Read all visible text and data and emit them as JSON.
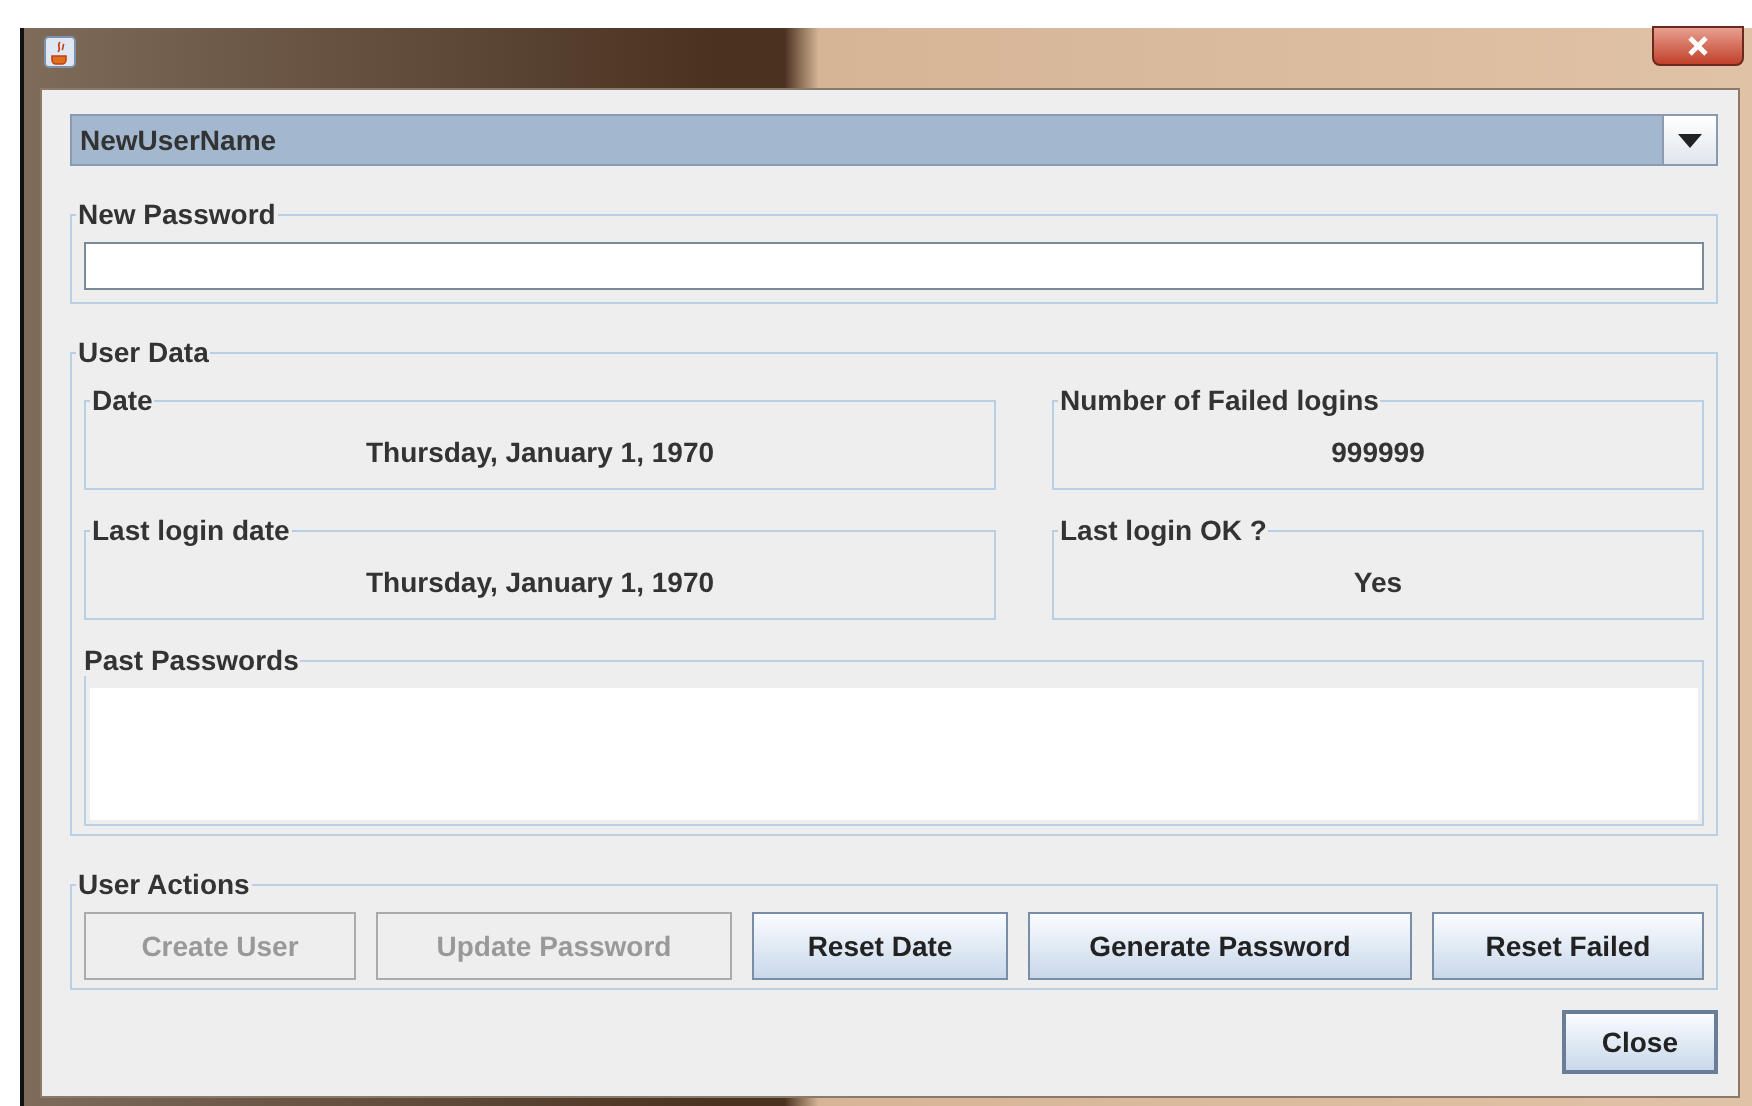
{
  "user_select": {
    "value": "NewUserName"
  },
  "new_password": {
    "title": "New Password"
  },
  "user_data": {
    "title": "User Data",
    "fields": [
      {
        "title": "Date",
        "value": "Thursday, January 1, 1970"
      },
      {
        "title": "Number of Failed logins",
        "value": "999999"
      },
      {
        "title": "Last login date",
        "value": "Thursday, January 1, 1970"
      },
      {
        "title": "Last login OK ?",
        "value": "Yes"
      }
    ],
    "past_passwords": {
      "title": "Past Passwords"
    }
  },
  "user_actions": {
    "title": "User Actions",
    "buttons": [
      {
        "label": "Create User",
        "disabled": true
      },
      {
        "label": "Update Password",
        "disabled": true
      },
      {
        "label": "Reset Date",
        "disabled": false
      },
      {
        "label": "Generate Password",
        "disabled": false
      },
      {
        "label": "Reset Failed",
        "disabled": false
      }
    ]
  },
  "close_button": {
    "label": "Close"
  }
}
